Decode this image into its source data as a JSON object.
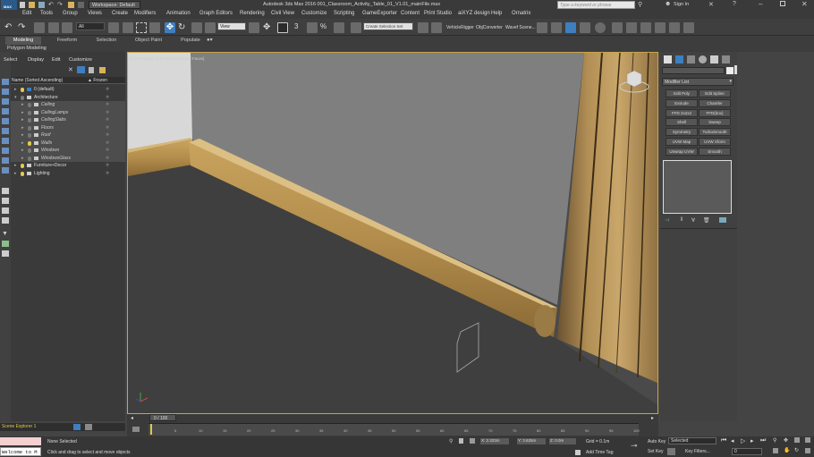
{
  "titlebar": {
    "app_label": "MAX",
    "workspace": "Workspace: Default",
    "title": "Autodesk 3ds Max 2016      001_Classroom_Activity_Table_01_V1.01_mainFile.max",
    "search_placeholder": "Type a keyword or phrase",
    "sign_in": "Sign In"
  },
  "menu": [
    "Edit",
    "Tools",
    "Group",
    "Views",
    "Create",
    "Modifiers",
    "Animation",
    "Graph Editors",
    "Rendering",
    "Civil View",
    "Customize",
    "Scripting",
    "GameExporter",
    "Content",
    "Print Studio",
    "aiXYZ design",
    "Help",
    "Ornatrix"
  ],
  "toolbar": {
    "selection_filter": "All",
    "ref_coord": "View",
    "named_selection": "Create Selection Set",
    "vehicle_rigger": "VehicleRigger",
    "obj_converter": "ObjConverter",
    "wavefront": "Wavef Scene..."
  },
  "ribbon": {
    "tabs": [
      "Modeling",
      "Freeform",
      "Selection",
      "Object Paint",
      "Populate"
    ],
    "active_tab": "Modeling",
    "sub_label": "Polygon Modeling"
  },
  "explorer": {
    "menu": [
      "Select",
      "Display",
      "Edit",
      "Customize"
    ],
    "header_name": "Name (Sorted Ascending)",
    "header_frozen": "▲ Frozen",
    "rows": [
      {
        "label": "0 (default)",
        "level": 0
      },
      {
        "label": "Architecture",
        "level": 0
      },
      {
        "label": "Ceiling",
        "level": 1
      },
      {
        "label": "CeilingLamps",
        "level": 1
      },
      {
        "label": "CeilingSlabs",
        "level": 1
      },
      {
        "label": "Floors",
        "level": 1
      },
      {
        "label": "Roof",
        "level": 1
      },
      {
        "label": "Walls",
        "level": 1
      },
      {
        "label": "Windows",
        "level": 1
      },
      {
        "label": "WindowsGlass",
        "level": 1
      },
      {
        "label": "Furniture+Decor",
        "level": 0
      },
      {
        "label": "Lighting",
        "level": 0
      }
    ],
    "footer": "Scene Explorer 1"
  },
  "viewport": {
    "label": "[+] [Perspective] [Realistic] [Edged Faces]"
  },
  "command_panel": {
    "object_name": "",
    "modifier_list": "Modifier List",
    "buttons": [
      [
        "Edit Poly",
        "Edit Spline"
      ],
      [
        "Extrude",
        "Chamfer"
      ],
      [
        "FFD 2x2x2",
        "FFD(box)"
      ],
      [
        "Shell",
        "Sweep"
      ],
      [
        "Symmetry",
        "TurboSmooth"
      ],
      [
        "UVW Map",
        "UVW Xform"
      ],
      [
        "Unwrap UVW",
        "Smooth"
      ]
    ]
  },
  "timeline": {
    "frame": "0 / 100",
    "ticks": [
      "0",
      "5",
      "10",
      "15",
      "20",
      "25",
      "30",
      "35",
      "40",
      "45",
      "50",
      "55",
      "60",
      "65",
      "70",
      "75",
      "80",
      "85",
      "90",
      "95",
      "100"
    ]
  },
  "status": {
    "listener": "Welcome to M",
    "selected": "None Selected",
    "prompt": "Click and drag to select and move objects",
    "x": "X: 2.323m",
    "y": "Y: 3.625m",
    "z": "Z: 0.0m",
    "grid": "Grid = 0.1m",
    "add_time_tag": "Add Time Tag",
    "auto_key": "Auto Key",
    "set_key": "Set Key",
    "key_mode": "Selected",
    "key_filters": "Key Filters...",
    "frame_field": "0"
  }
}
